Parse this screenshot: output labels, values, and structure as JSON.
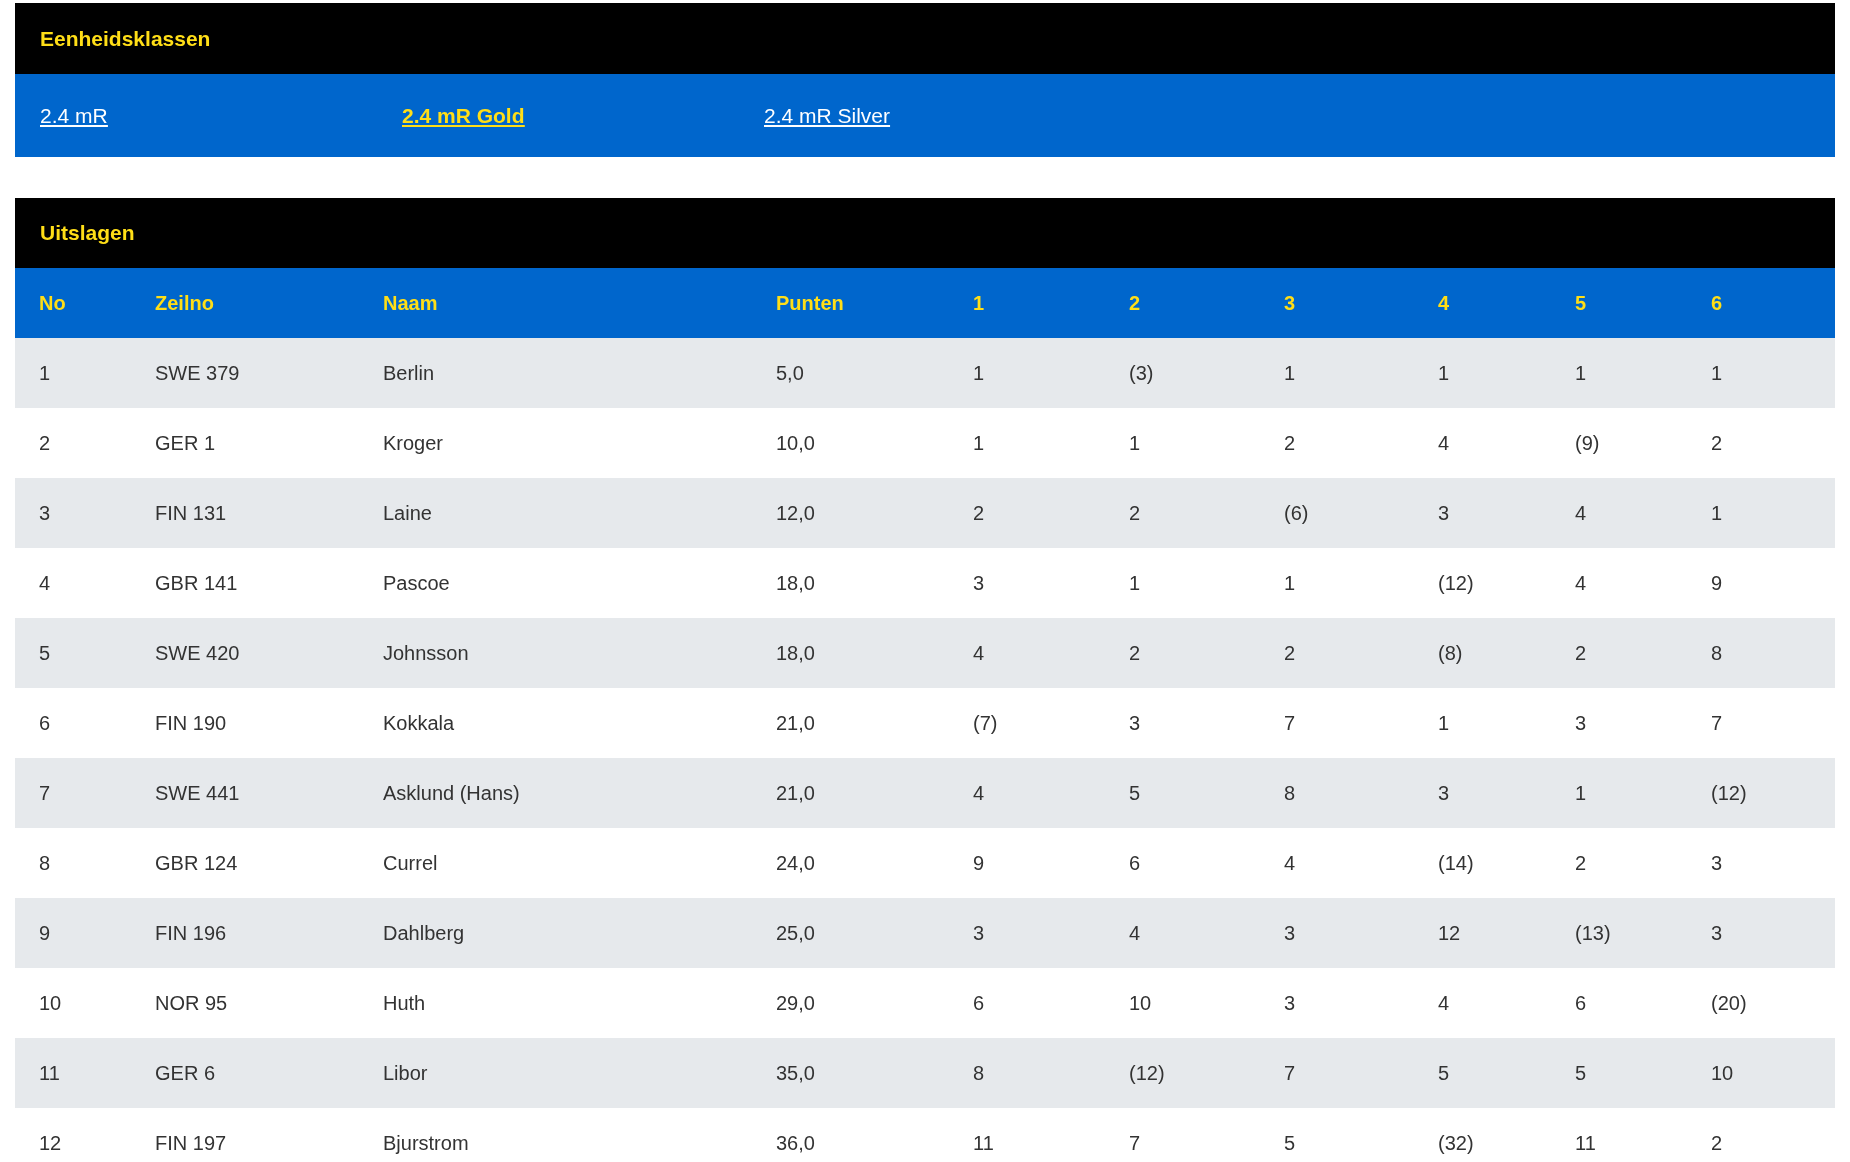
{
  "classes": {
    "title": "Eenheidsklassen",
    "links": [
      {
        "label": "2.4 mR",
        "selected": false
      },
      {
        "label": "2.4 mR Gold",
        "selected": true
      },
      {
        "label": "2.4 mR Silver",
        "selected": false
      }
    ]
  },
  "results": {
    "title": "Uitslagen",
    "columns": [
      "No",
      "Zeilno",
      "Naam",
      "Punten",
      "1",
      "2",
      "3",
      "4",
      "5",
      "6"
    ],
    "rows": [
      [
        "1",
        "SWE 379",
        "Berlin",
        "5,0",
        "1",
        "(3)",
        "1",
        "1",
        "1",
        "1"
      ],
      [
        "2",
        "GER 1",
        "Kroger",
        "10,0",
        "1",
        "1",
        "2",
        "4",
        "(9)",
        "2"
      ],
      [
        "3",
        "FIN 131",
        "Laine",
        "12,0",
        "2",
        "2",
        "(6)",
        "3",
        "4",
        "1"
      ],
      [
        "4",
        "GBR 141",
        "Pascoe",
        "18,0",
        "3",
        "1",
        "1",
        "(12)",
        "4",
        "9"
      ],
      [
        "5",
        "SWE 420",
        "Johnsson",
        "18,0",
        "4",
        "2",
        "2",
        "(8)",
        "2",
        "8"
      ],
      [
        "6",
        "FIN 190",
        "Kokkala",
        "21,0",
        "(7)",
        "3",
        "7",
        "1",
        "3",
        "7"
      ],
      [
        "7",
        "SWE 441",
        "Asklund (Hans)",
        "21,0",
        "4",
        "5",
        "8",
        "3",
        "1",
        "(12)"
      ],
      [
        "8",
        "GBR 124",
        "Currel",
        "24,0",
        "9",
        "6",
        "4",
        "(14)",
        "2",
        "3"
      ],
      [
        "9",
        "FIN 196",
        "Dahlberg",
        "25,0",
        "3",
        "4",
        "3",
        "12",
        "(13)",
        "3"
      ],
      [
        "10",
        "NOR 95",
        "Huth",
        "29,0",
        "6",
        "10",
        "3",
        "4",
        "6",
        "(20)"
      ],
      [
        "11",
        "GER 6",
        "Libor",
        "35,0",
        "8",
        "(12)",
        "7",
        "5",
        "5",
        "10"
      ],
      [
        "12",
        "FIN 197",
        "Bjurstrom",
        "36,0",
        "11",
        "7",
        "5",
        "(32)",
        "11",
        "2"
      ]
    ]
  }
}
